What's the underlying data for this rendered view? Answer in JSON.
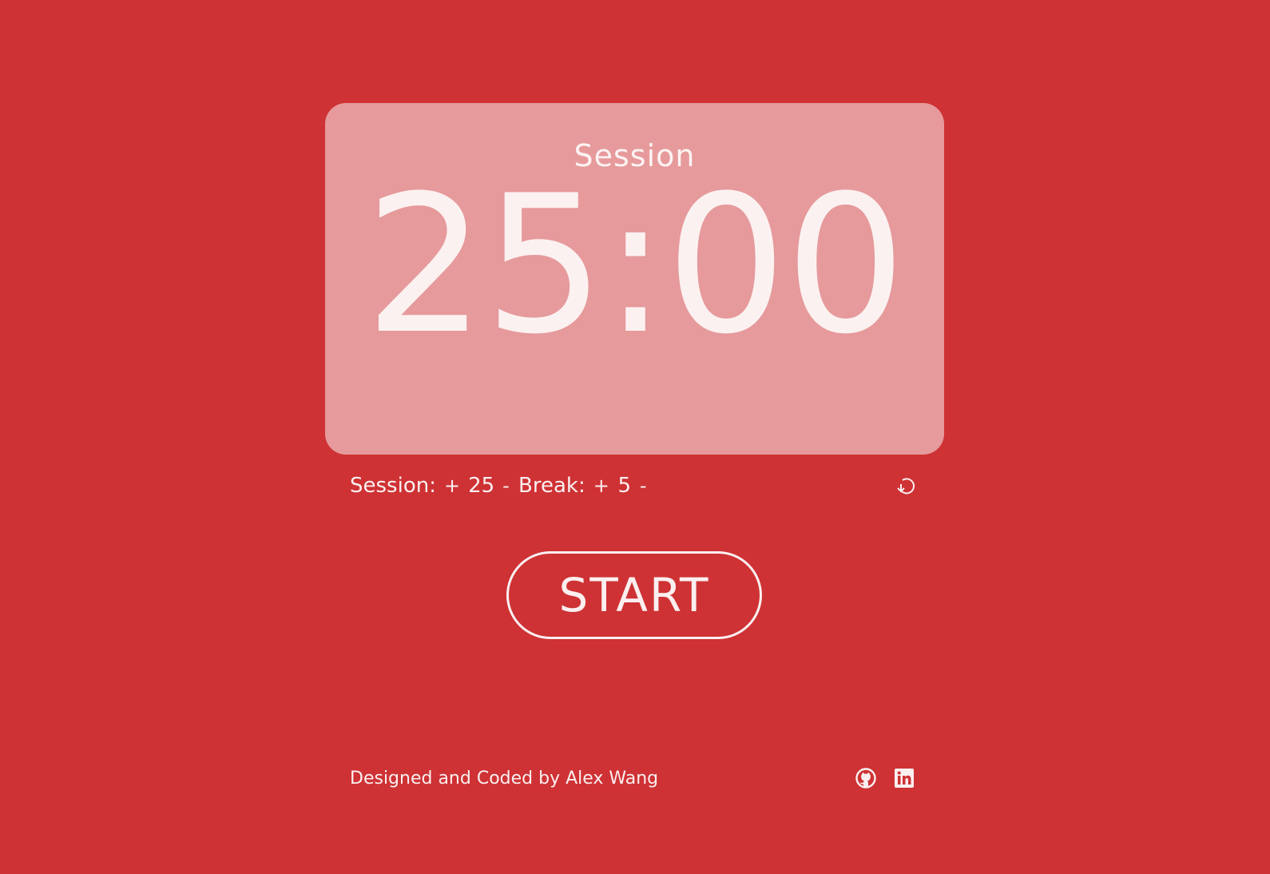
{
  "timer": {
    "mode_label": "Session",
    "time": "25:00"
  },
  "controls": {
    "session": {
      "label": "Session:",
      "increment_label": "+",
      "value": "25",
      "decrement_label": "-"
    },
    "break": {
      "label": "Break:",
      "increment_label": "+",
      "value": "5",
      "decrement_label": "-"
    },
    "reset_icon": "reset-icon"
  },
  "start_button": {
    "label": "START"
  },
  "footer": {
    "credit": "Designed and Coded by Alex Wang",
    "links": [
      {
        "icon": "github-icon"
      },
      {
        "icon": "linkedin-icon"
      }
    ]
  },
  "colors": {
    "background": "#ce3234",
    "card": "#e69a9b",
    "text": "#fbeff0"
  }
}
